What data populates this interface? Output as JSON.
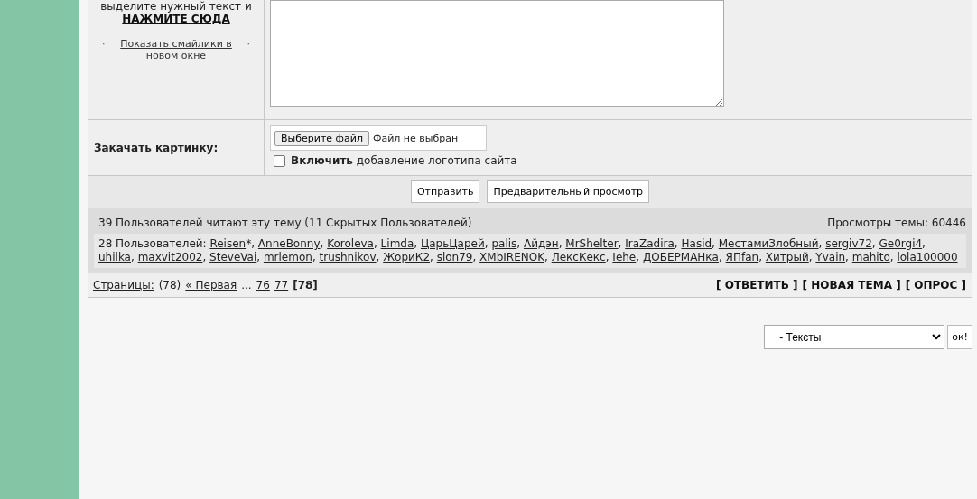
{
  "smilies_panel": {
    "hint": "выделите нужный текст и",
    "hint_link": "НАЖМИТЕ СЮДА",
    "prefix": "·",
    "show_link": "Показать смайлики в новом окне",
    "suffix": "·"
  },
  "upload": {
    "label": "Закачать картинку:",
    "file_button": "Выберите файл",
    "file_status": "Файл не выбран",
    "logo_option": {
      "checked": false,
      "label": "**Включить** добавление логотипа сайта"
    }
  },
  "buttons": [
    "Отправить",
    "Предварительный просмотр"
  ],
  "readers": {
    "summary": "39 Пользователей читают эту тему (11 Скрытых Пользователей)",
    "views": "Просмотры темы: 60446",
    "list_label": "28 Пользователей:",
    "separator": ", ",
    "users": [
      {
        "name": "Reisen",
        "suffix": "*"
      },
      {
        "name": "AnneBonny"
      },
      {
        "name": "Koroleva"
      },
      {
        "name": "Limda"
      },
      {
        "name": "ЦарьЦарей"
      },
      {
        "name": "palis"
      },
      {
        "name": "Айдэн"
      },
      {
        "name": "MrShelter"
      },
      {
        "name": "IraZadira"
      },
      {
        "name": "Hasid"
      },
      {
        "name": "МестамиЗлобный"
      },
      {
        "name": "sergiv72"
      },
      {
        "name": "Ge0rgi4"
      },
      {
        "name": "uhilka"
      },
      {
        "name": "maxvit2002"
      },
      {
        "name": "SteveVai"
      },
      {
        "name": "mrlemon"
      },
      {
        "name": "trushnikov"
      },
      {
        "name": "ЖориК2"
      },
      {
        "name": "slon79"
      },
      {
        "name": "XMbIRENOK"
      },
      {
        "name": "ЛексКекс"
      },
      {
        "name": "Iehe"
      },
      {
        "name": "ДОБЕРМАНка"
      },
      {
        "name": "ЯПfan"
      },
      {
        "name": "Хитрый"
      },
      {
        "name": "Yvain"
      },
      {
        "name": "mahito"
      },
      {
        "name": "lola100000"
      }
    ]
  },
  "pagination": {
    "label": "Страницы:",
    "count": "(78)",
    "first": "« Первая",
    "ellipsis": "...",
    "pages": [
      {
        "label": "76",
        "selected": false
      },
      {
        "label": "77",
        "selected": false
      },
      {
        "label": "[78]",
        "selected": true
      }
    ]
  },
  "actions": [
    "[ ОТВЕТИТЬ ]",
    "[ НОВАЯ ТЕМА ]",
    "[ ОПРОС ]"
  ],
  "jump": {
    "value": "- Тексты",
    "button": "ок!"
  }
}
